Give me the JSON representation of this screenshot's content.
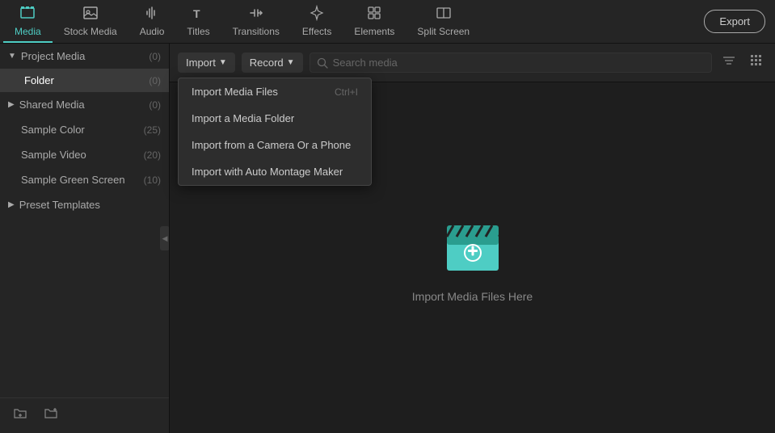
{
  "nav": {
    "items": [
      {
        "id": "media",
        "label": "Media",
        "icon": "🖥",
        "active": true
      },
      {
        "id": "stock-media",
        "label": "Stock Media",
        "icon": "🎬"
      },
      {
        "id": "audio",
        "label": "Audio",
        "icon": "🎵"
      },
      {
        "id": "titles",
        "label": "Titles",
        "icon": "T"
      },
      {
        "id": "transitions",
        "label": "Transitions",
        "icon": "↔"
      },
      {
        "id": "effects",
        "label": "Effects",
        "icon": "✦"
      },
      {
        "id": "elements",
        "label": "Elements",
        "icon": "◈"
      },
      {
        "id": "split-screen",
        "label": "Split Screen",
        "icon": "⊞"
      }
    ],
    "export_label": "Export"
  },
  "sidebar": {
    "sections": [
      {
        "id": "project-media",
        "label": "Project Media",
        "count": "(0)",
        "expanded": true,
        "children": [
          {
            "id": "folder",
            "label": "Folder",
            "count": "(0)",
            "active": true
          }
        ]
      },
      {
        "id": "shared-media",
        "label": "Shared Media",
        "count": "(0)",
        "expanded": false
      },
      {
        "id": "sample-color",
        "label": "Sample Color",
        "count": "(25)"
      },
      {
        "id": "sample-video",
        "label": "Sample Video",
        "count": "(20)"
      },
      {
        "id": "sample-green",
        "label": "Sample Green Screen",
        "count": "(10)"
      },
      {
        "id": "preset-templates",
        "label": "Preset Templates",
        "count": "",
        "expanded": false
      }
    ],
    "bottom_buttons": [
      {
        "id": "new-folder",
        "icon": "📁"
      },
      {
        "id": "add-media",
        "icon": "📂"
      }
    ]
  },
  "toolbar": {
    "import_label": "Import",
    "record_label": "Record",
    "search_placeholder": "Search media"
  },
  "dropdown": {
    "items": [
      {
        "id": "import-files",
        "label": "Import Media Files",
        "shortcut": "Ctrl+I"
      },
      {
        "id": "import-folder",
        "label": "Import a Media Folder",
        "shortcut": ""
      },
      {
        "id": "import-camera",
        "label": "Import from a Camera Or a Phone",
        "shortcut": ""
      },
      {
        "id": "import-montage",
        "label": "Import with Auto Montage Maker",
        "shortcut": ""
      }
    ]
  },
  "content": {
    "empty_hint": "Import Media Files Here"
  },
  "colors": {
    "accent": "#4ecdc4",
    "bg_dark": "#1e1e1e",
    "bg_panel": "#252525",
    "clapper_body": "#4ecdc4",
    "clapper_stripe": "#2a9d8f"
  }
}
